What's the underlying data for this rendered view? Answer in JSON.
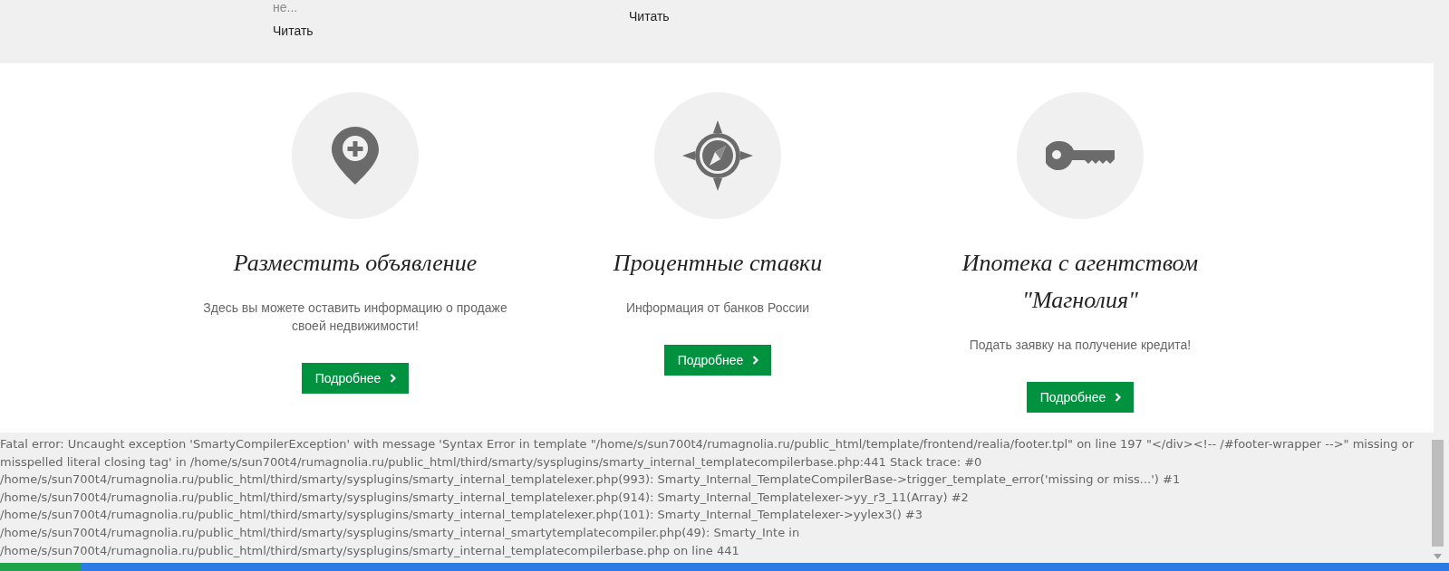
{
  "top_strip": {
    "columns": [
      {
        "excerpt": "не...",
        "link": "Читать"
      },
      {
        "link": "Читать"
      }
    ]
  },
  "features": [
    {
      "kind": "pin",
      "title": "Разместить объявление",
      "description": "Здесь вы можете оставить информацию о продаже своей недвижимости!",
      "button": "Подробнее"
    },
    {
      "kind": "compass",
      "title": "Процентные ставки",
      "description": "Информация от банков России",
      "button": "Подробнее"
    },
    {
      "kind": "key",
      "title": "Ипотека с агентством \"Магнолия\"",
      "description": "Подать заявку на получение кредита!",
      "button": "Подробнее"
    }
  ],
  "error_message": "Fatal error: Uncaught exception 'SmartyCompilerException' with message 'Syntax Error in template \"/home/s/sun700t4/rumagnolia.ru/public_html/template/frontend/realia/footer.tpl\" on line 197 \"</div><!-- /#footer-wrapper -->\" missing or misspelled literal closing tag' in /home/s/sun700t4/rumagnolia.ru/public_html/third/smarty/sysplugins/smarty_internal_templatecompilerbase.php:441 Stack trace: #0 /home/s/sun700t4/rumagnolia.ru/public_html/third/smarty/sysplugins/smarty_internal_templatelexer.php(993): Smarty_Internal_TemplateCompilerBase->trigger_template_error('missing or miss...') #1 /home/s/sun700t4/rumagnolia.ru/public_html/third/smarty/sysplugins/smarty_internal_templatelexer.php(914): Smarty_Internal_Templatelexer->yy_r3_11(Array) #2 /home/s/sun700t4/rumagnolia.ru/public_html/third/smarty/sysplugins/smarty_internal_templatelexer.php(101): Smarty_Internal_Templatelexer->yylex3() #3 /home/s/sun700t4/rumagnolia.ru/public_html/third/smarty/sysplugins/smarty_internal_smartytemplatecompiler.php(49): Smarty_Inte in /home/s/sun700t4/rumagnolia.ru/public_html/third/smarty/sysplugins/smarty_internal_templatecompilerbase.php on line 441"
}
